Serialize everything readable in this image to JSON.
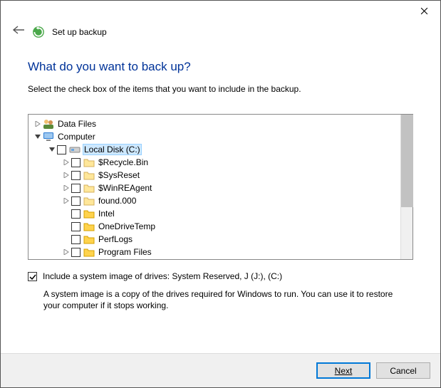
{
  "window": {
    "title": "Set up backup"
  },
  "page": {
    "question": "What do you want to back up?",
    "instructions": "Select the check box of the items that you want to include in the backup."
  },
  "tree": {
    "data_files": "Data Files",
    "computer": "Computer",
    "local_disk": "Local Disk (C:)",
    "items": [
      "$Recycle.Bin",
      "$SysReset",
      "$WinREAgent",
      "found.000",
      "Intel",
      "OneDriveTemp",
      "PerfLogs",
      "Program Files"
    ]
  },
  "system_image": {
    "label": "Include a system image of drives: System Reserved, J (J:), (C:)",
    "description": "A system image is a copy of the drives required for Windows to run. You can use it to restore your computer if it stops working."
  },
  "buttons": {
    "next": "Next",
    "cancel": "Cancel"
  }
}
